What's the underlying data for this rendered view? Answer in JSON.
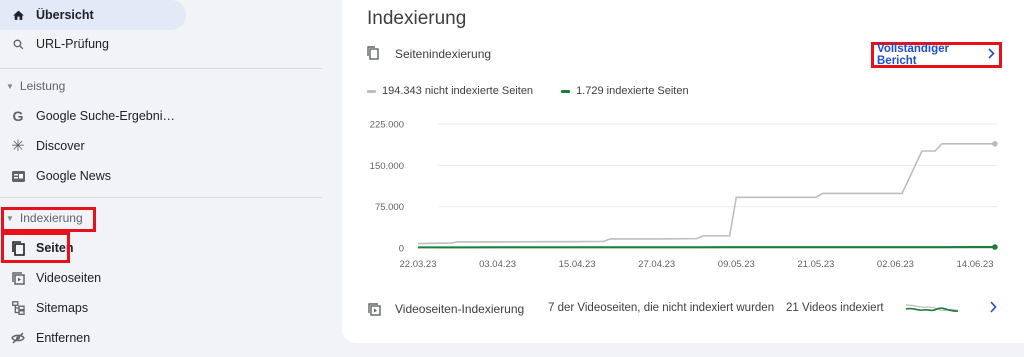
{
  "sidebar": {
    "items_top": [
      {
        "label": "Übersicht",
        "icon": "home-icon"
      },
      {
        "label": "URL-Prüfung",
        "icon": "search-icon"
      }
    ],
    "sections": [
      {
        "title": "Leistung",
        "items": [
          {
            "label": "Google Suche-Ergebnis...",
            "icon": "google-g-icon"
          },
          {
            "label": "Discover",
            "icon": "asterisk-icon"
          },
          {
            "label": "Google News",
            "icon": "news-icon"
          }
        ]
      },
      {
        "title": "Indexierung",
        "items": [
          {
            "label": "Seiten",
            "icon": "pages-icon"
          },
          {
            "label": "Videoseiten",
            "icon": "video-pages-icon"
          },
          {
            "label": "Sitemaps",
            "icon": "sitemap-icon"
          },
          {
            "label": "Entfernen",
            "icon": "eye-off-icon"
          }
        ]
      }
    ]
  },
  "main": {
    "title": "Indexierung",
    "section_label": "Seitenindexierung",
    "report_link": "Vollständiger Bericht",
    "legend": [
      {
        "label": "194.343 nicht indexierte Seiten",
        "color": "#bdbdbd"
      },
      {
        "label": "1.729 indexierte Seiten",
        "color": "#188038"
      }
    ],
    "video_row": {
      "title": "Videoseiten-Indexierung",
      "not_indexed": "7 der Videoseiten, die nicht indexiert wurden",
      "indexed": "21 Videos indexiert"
    }
  },
  "chart_data": {
    "type": "line",
    "yticks": [
      "225.000",
      "150.000",
      "75.000",
      "0"
    ],
    "ytick_values": [
      225000,
      150000,
      75000,
      0
    ],
    "xticks": [
      "22.03.23",
      "03.04.23",
      "15.04.23",
      "27.04.23",
      "09.05.23",
      "21.05.23",
      "02.06.23",
      "14.06.23"
    ],
    "ylim": [
      0,
      225000
    ],
    "x": [
      "22.03.23",
      "27.03.23",
      "28.03.23",
      "03.04.23",
      "10.04.23",
      "14.04.23",
      "19.04.23",
      "20.04.23",
      "27.04.23",
      "03.05.23",
      "04.05.23",
      "08.05.23",
      "09.05.23",
      "21.05.23",
      "22.05.23",
      "02.06.23",
      "03.06.23",
      "06.06.23",
      "08.06.23",
      "09.06.23",
      "14.06.23",
      "17.06.23"
    ],
    "series": [
      {
        "name": "194.343 nicht indexierte Seiten",
        "color": "#bdbdbd",
        "values": [
          8000,
          9000,
          11000,
          11000,
          11500,
          11500,
          12000,
          16500,
          16500,
          17000,
          22000,
          22000,
          92000,
          92000,
          99000,
          99000,
          99000,
          176000,
          176000,
          189000,
          189000,
          189000
        ]
      },
      {
        "name": "1.729 indexierte Seiten",
        "color": "#188038",
        "values": [
          1200,
          1200,
          1200,
          1300,
          1300,
          1300,
          1300,
          1400,
          1400,
          1400,
          1400,
          1500,
          1500,
          1500,
          1600,
          1600,
          1600,
          1700,
          1700,
          1700,
          1729,
          1729
        ]
      }
    ]
  }
}
